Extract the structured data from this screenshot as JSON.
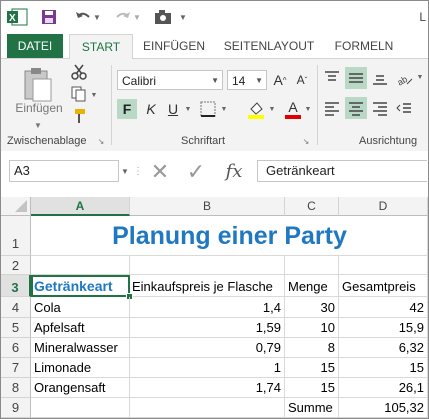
{
  "window": {
    "title_fragment": "L"
  },
  "tabs": [
    "DATEI",
    "START",
    "EINFÜGEN",
    "SEITENLAYOUT",
    "FORMELN"
  ],
  "ribbon": {
    "clipboard": {
      "paste_label": "Einfügen",
      "group_label": "Zwischenablage"
    },
    "font": {
      "name": "Calibri",
      "size": "14",
      "bold": "F",
      "italic": "K",
      "underline": "U",
      "group_label": "Schriftart"
    },
    "alignment": {
      "group_label": "Ausrichtung"
    }
  },
  "formula_bar": {
    "name_box": "A3",
    "fx": "fx",
    "content": "Getränkeart"
  },
  "colors": {
    "accent": "#217346",
    "title": "#1f78c1",
    "fill_yellow": "#ffff00",
    "font_red": "#e00000"
  },
  "sheet": {
    "columns": [
      "A",
      "B",
      "C",
      "D"
    ],
    "rows": [
      "1",
      "2",
      "3",
      "4",
      "5",
      "6",
      "7",
      "8",
      "9"
    ],
    "title": "Planung einer Party",
    "headers": [
      "Getränkeart",
      "Einkaufspreis je Flasche",
      "Menge",
      "Gesamtpreis"
    ],
    "data": [
      [
        "Cola",
        "1,4",
        "30",
        "42"
      ],
      [
        "Apfelsaft",
        "1,59",
        "10",
        "15,9"
      ],
      [
        "Mineralwasser",
        "0,79",
        "8",
        "6,32"
      ],
      [
        "Limonade",
        "1",
        "15",
        "15"
      ],
      [
        "Orangensaft",
        "1,74",
        "15",
        "26,1"
      ]
    ],
    "total_label": "Summe",
    "total_value": "105,32"
  }
}
